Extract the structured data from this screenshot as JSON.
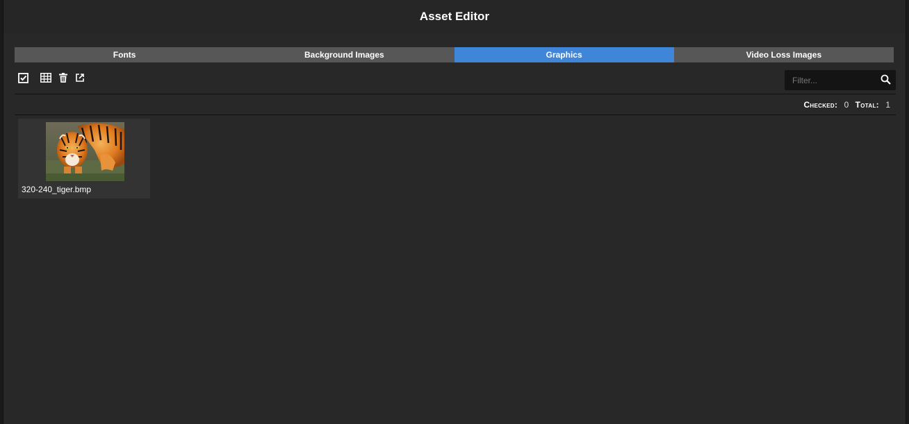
{
  "window": {
    "title": "Asset Editor"
  },
  "tabs": [
    {
      "label": "Fonts",
      "active": false
    },
    {
      "label": "Background Images",
      "active": false
    },
    {
      "label": "Graphics",
      "active": true
    },
    {
      "label": "Video Loss Images",
      "active": false
    }
  ],
  "toolbar": {
    "icons": [
      "select-all-checkbox-icon",
      "grid-view-icon",
      "trash-icon",
      "export-icon"
    ],
    "filter_placeholder": "Filter...",
    "filter_value": ""
  },
  "stats": {
    "checked_label": "Checked:",
    "checked_value": "0",
    "total_label": "Total:",
    "total_value": "1"
  },
  "assets": [
    {
      "name": "320-240_tiger.bmp",
      "thumbnail": "tiger-image"
    }
  ],
  "colors": {
    "background": "#282828",
    "tab": "#575757",
    "tab_active": "#3f86d8"
  }
}
